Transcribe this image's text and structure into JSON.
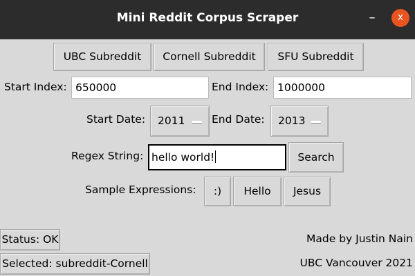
{
  "window": {
    "title": "Mini Reddit Corpus Scraper",
    "minimize_glyph": "–",
    "close_glyph": "x"
  },
  "subreddit_buttons": [
    "UBC Subreddit",
    "Cornell Subreddit",
    "SFU Subreddit"
  ],
  "index": {
    "start_label": "Start Index:",
    "start_value": "650000",
    "end_label": "End Index:",
    "end_value": "1000000"
  },
  "dates": {
    "start_label": "Start Date:",
    "start_value": "2011",
    "end_label": "End Date:",
    "end_value": "2013"
  },
  "regex": {
    "label": "Regex String:",
    "value": "hello world!",
    "search_label": "Search"
  },
  "samples": {
    "label": "Sample Expressions:",
    "items": [
      ":)",
      "Hello",
      "Jesus"
    ]
  },
  "status": {
    "status_text": "Status: OK",
    "selected_text": "Selected: subreddit-Cornell"
  },
  "credits": {
    "author": "Made by Justin Nain",
    "school": "UBC Vancouver 2021"
  },
  "colors": {
    "titlebar": "#2c2c2c",
    "close_button": "#e95420",
    "background": "#d9d9d9"
  },
  "icons": {
    "minimize": "minimize-icon",
    "close": "close-icon",
    "dropdown": "option-menu-indicator"
  }
}
